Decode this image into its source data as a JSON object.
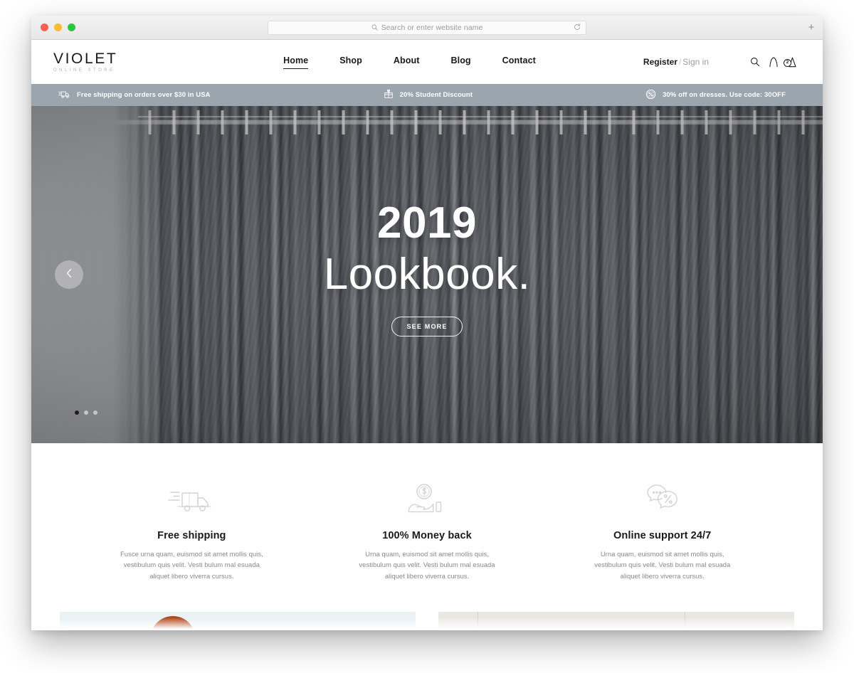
{
  "browser": {
    "url_placeholder": "Search or enter website name",
    "search_icon": "search-icon",
    "reload_icon": "reload-icon",
    "newtab_label": "+"
  },
  "header": {
    "logo_name": "VIOLET",
    "logo_sub": "ONLINE STORE",
    "nav": [
      {
        "label": "Home",
        "active": true
      },
      {
        "label": "Shop",
        "active": false
      },
      {
        "label": "About",
        "active": false
      },
      {
        "label": "Blog",
        "active": false
      },
      {
        "label": "Contact",
        "active": false
      }
    ],
    "auth": {
      "register": "Register",
      "separator": "/",
      "signin": "Sign in"
    },
    "icons": {
      "search": "search-icon",
      "account": "user-account-icon",
      "cart": "shopping-bag-icon"
    },
    "cart_count": "2"
  },
  "announcement": [
    {
      "icon": "delivery-truck-icon",
      "text": "Free shipping on orders over $30 in USA"
    },
    {
      "icon": "gift-box-icon",
      "text": "20% Student Discount"
    },
    {
      "icon": "percent-circle-icon",
      "text": "30% off on dresses. Use code: 30OFF"
    }
  ],
  "hero": {
    "year": "2019",
    "title": "Lookbook.",
    "cta_label": "SEE MORE",
    "prev_icon": "chevron-left-icon",
    "slides": 3,
    "active_slide": 1
  },
  "features": [
    {
      "icon": "delivery-truck-icon",
      "title": "Free shipping",
      "text": "Fusce urna quam, euismod sit amet mollis quis, vestibulum quis velit. Vesti bulum mal esuada aliquet libero viverra cursus."
    },
    {
      "icon": "hand-holding-coin-icon",
      "title": "100% Money back",
      "text": "Urna quam, euismod sit amet mollis quis, vestibulum quis velit. Vesti bulum mal esuada aliquet libero viverra cursus."
    },
    {
      "icon": "chat-bubbles-percent-icon",
      "title": "Online support 24/7",
      "text": "Urna quam, euismod sit amet mollis quis, vestibulum quis velit. Vesti bulum mal esuada aliquet libero viverra cursus."
    }
  ],
  "colors": {
    "announcement_bar": "#9aa5ad",
    "text_dark": "#1a1a1a",
    "text_muted": "#8a8a8a",
    "accent_white": "#ffffff"
  }
}
